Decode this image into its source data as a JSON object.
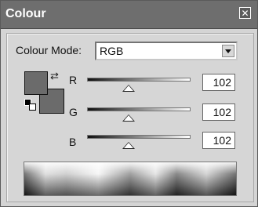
{
  "window": {
    "title": "Colour",
    "close_icon": "close-icon"
  },
  "colour_mode": {
    "label": "Colour Mode:",
    "selected": "RGB"
  },
  "channels": [
    {
      "label": "R",
      "value": "102",
      "fraction": 0.4
    },
    {
      "label": "G",
      "value": "102",
      "fraction": 0.4
    },
    {
      "label": "B",
      "value": "102",
      "fraction": 0.4
    }
  ],
  "swatches": {
    "foreground_color": "#6b6b6b",
    "background_color": "#6b6b6b",
    "swap_icon": "swap-icon"
  }
}
